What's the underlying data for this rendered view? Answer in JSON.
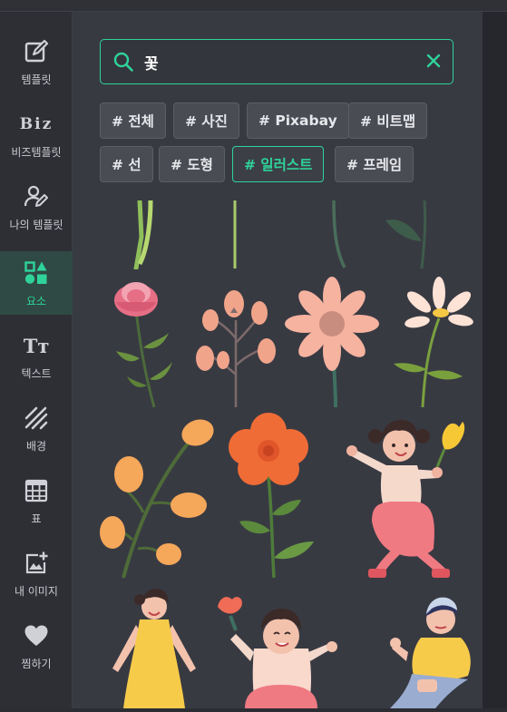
{
  "sidebar": {
    "items": [
      {
        "label": "템플릿",
        "icon": "template-icon",
        "active": false
      },
      {
        "label": "비즈템플릿",
        "icon": "biz-icon",
        "active": false
      },
      {
        "label": "나의 템플릿",
        "icon": "my-template-icon",
        "active": false
      },
      {
        "label": "요소",
        "icon": "elements-icon",
        "active": true
      },
      {
        "label": "텍스트",
        "icon": "text-icon",
        "active": false
      },
      {
        "label": "배경",
        "icon": "background-icon",
        "active": false
      },
      {
        "label": "표",
        "icon": "table-icon",
        "active": false
      },
      {
        "label": "내 이미지",
        "icon": "add-image-icon",
        "active": false
      },
      {
        "label": "찜하기",
        "icon": "heart-icon",
        "active": false
      }
    ],
    "biz_glyph": "Biz",
    "text_glyph": "Tт"
  },
  "search": {
    "value": "꽃",
    "placeholder": ""
  },
  "filters": [
    {
      "label": "# 전체",
      "active": false
    },
    {
      "label": "# 사진",
      "active": false
    },
    {
      "label": "# Pixabay",
      "active": false
    },
    {
      "label": "# 비트맵",
      "active": false
    },
    {
      "label": "# 선",
      "active": false
    },
    {
      "label": "# 도형",
      "active": false
    },
    {
      "label": "# 일러스트",
      "active": true
    },
    {
      "label": "# 프레임",
      "active": false
    }
  ],
  "colors": {
    "accent": "#2fd39a",
    "panel_bg": "#383a42",
    "sidebar_bg": "#2d2f35"
  }
}
